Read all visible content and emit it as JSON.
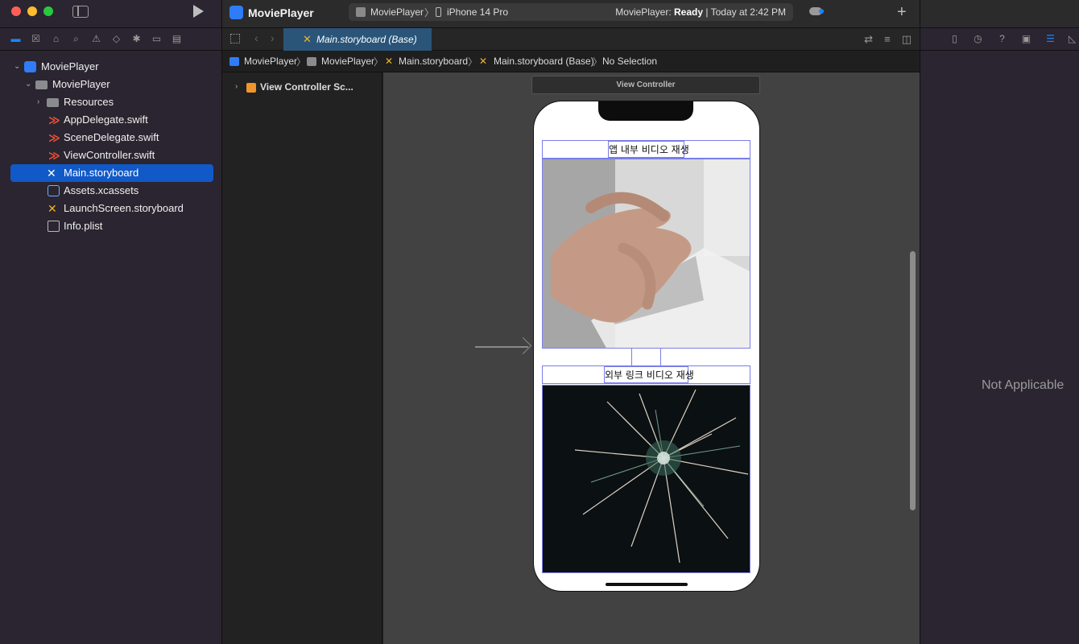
{
  "app": {
    "title": "MoviePlayer"
  },
  "toolbar": {
    "scheme": "MoviePlayer",
    "device": "iPhone 14 Pro",
    "status_prefix": "MoviePlayer: ",
    "status_state": "Ready",
    "status_suffix": " | Today at 2:42 PM"
  },
  "navigator": {
    "tabs": [
      "folder-icon",
      "x-square-icon",
      "hierarchy-icon",
      "search-icon",
      "warning-icon",
      "diamond-icon",
      "spray-icon",
      "tag-icon",
      "report-icon"
    ],
    "tree": [
      {
        "label": "MoviePlayer",
        "icon": "project-icon",
        "level": 0,
        "disclosure": "⌄"
      },
      {
        "label": "MoviePlayer",
        "icon": "folder-icon",
        "level": 1,
        "disclosure": "⌄"
      },
      {
        "label": "Resources",
        "icon": "folder-icon",
        "level": 2,
        "disclosure": "›"
      },
      {
        "label": "AppDelegate.swift",
        "icon": "swift-icon",
        "level": 2
      },
      {
        "label": "SceneDelegate.swift",
        "icon": "swift-icon",
        "level": 2
      },
      {
        "label": "ViewController.swift",
        "icon": "swift-icon",
        "level": 2
      },
      {
        "label": "Main.storyboard",
        "icon": "storyboard-icon",
        "level": 2,
        "selected": true
      },
      {
        "label": "Assets.xcassets",
        "icon": "assets-icon",
        "level": 2
      },
      {
        "label": "LaunchScreen.storyboard",
        "icon": "storyboard-icon",
        "level": 2
      },
      {
        "label": "Info.plist",
        "icon": "plist-icon",
        "level": 2
      }
    ]
  },
  "editor": {
    "tab_label": "Main.storyboard (Base)",
    "breadcrumb": [
      "MoviePlayer",
      "MoviePlayer",
      "Main.storyboard",
      "Main.storyboard (Base)",
      "No Selection"
    ],
    "outline_item": "View Controller Sc...",
    "scene_header": "View Controller",
    "label_1": "앱 내부 비디오 재생",
    "label_2": "외부 링크 비디오 재생"
  },
  "inspector": {
    "empty_text": "Not Applicable"
  },
  "colors": {
    "accent": "#1b84ff",
    "selection": "#1159c7",
    "constraint": "#7b7de8"
  }
}
